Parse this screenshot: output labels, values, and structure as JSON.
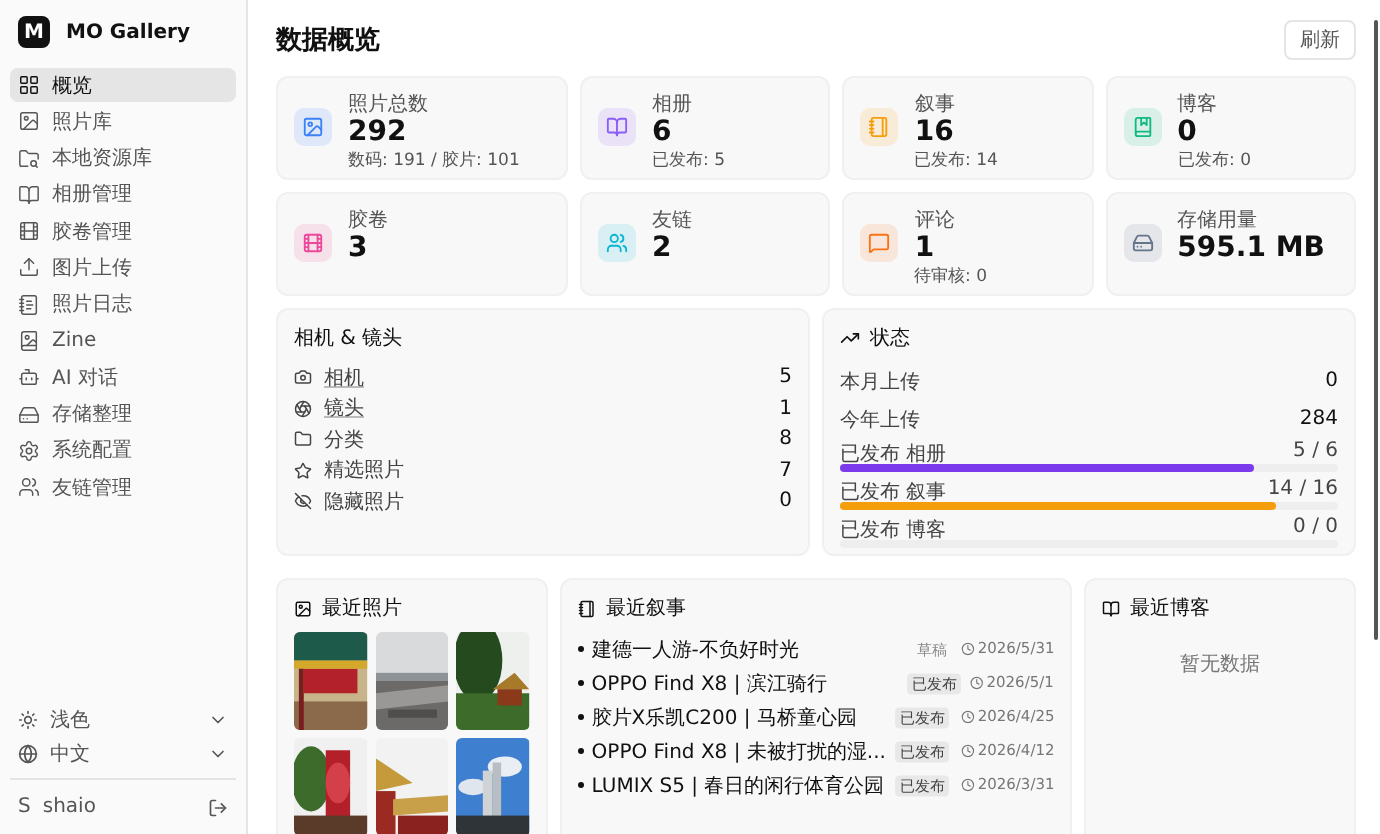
{
  "app": {
    "logo": "M",
    "name": "MO Gallery"
  },
  "sidebar": {
    "items": [
      {
        "label": "概览",
        "selected": true
      },
      {
        "label": "照片库",
        "selected": false
      },
      {
        "label": "本地资源库",
        "selected": false
      },
      {
        "label": "相册管理",
        "selected": false
      },
      {
        "label": "胶卷管理",
        "selected": false
      },
      {
        "label": "图片上传",
        "selected": false
      },
      {
        "label": "照片日志",
        "selected": false
      },
      {
        "label": "Zine",
        "selected": false
      },
      {
        "label": "AI 对话",
        "selected": false
      },
      {
        "label": "存储整理",
        "selected": false
      },
      {
        "label": "系统配置",
        "selected": false
      },
      {
        "label": "友链管理",
        "selected": false
      }
    ],
    "theme": "浅色",
    "language": "中文",
    "user": {
      "avatar": "S",
      "name": "shaio"
    }
  },
  "header": {
    "title": "数据概览",
    "refresh": "刷新"
  },
  "stats": [
    {
      "label": "照片总数",
      "value": "292",
      "sub": "数码: 191 / 胶片: 101",
      "color": "#3b82f6"
    },
    {
      "label": "相册",
      "value": "6",
      "sub": "已发布: 5",
      "color": "#8b5cf6"
    },
    {
      "label": "叙事",
      "value": "16",
      "sub": "已发布: 14",
      "color": "#f59e0b"
    },
    {
      "label": "博客",
      "value": "0",
      "sub": "已发布: 0",
      "color": "#10b981"
    },
    {
      "label": "胶卷",
      "value": "3",
      "color": "#ec4899"
    },
    {
      "label": "友链",
      "value": "2",
      "color": "#06b6d4"
    },
    {
      "label": "评论",
      "value": "1",
      "sub": "待审核: 0",
      "color": "#f97316"
    },
    {
      "label": "存储用量",
      "value": "595.1 MB",
      "color": "#64748b"
    }
  ],
  "camera_panel": {
    "title": "相机 & 镜头",
    "items": [
      {
        "label": "相机",
        "count": "5",
        "linked": true
      },
      {
        "label": "镜头",
        "count": "1",
        "linked": true
      },
      {
        "label": "分类",
        "count": "8",
        "linked": false
      },
      {
        "label": "精选照片",
        "count": "7",
        "linked": false
      },
      {
        "label": "隐藏照片",
        "count": "0",
        "linked": false
      }
    ]
  },
  "status_panel": {
    "title": "状态",
    "rows": [
      {
        "label": "本月上传",
        "value": "0"
      },
      {
        "label": "今年上传",
        "value": "284"
      }
    ],
    "progress": [
      {
        "label": "已发布 相册",
        "reading": "5 / 6",
        "level": 0.833,
        "color": "#7c3aed"
      },
      {
        "label": "已发布 叙事",
        "reading": "14 / 16",
        "level": 0.875,
        "color": "#f59e0b"
      },
      {
        "label": "已发布 博客",
        "reading": "0 / 0"
      }
    ]
  },
  "recent_photos": {
    "title": "最近照片"
  },
  "recent_stories": {
    "title": "最近叙事",
    "items": [
      {
        "title": "建德一人游-不负好时光",
        "status": "草稿",
        "draft": true,
        "date": "2026/5/31"
      },
      {
        "title": "OPPO Find X8 | 滨江骑行",
        "status": "已发布",
        "draft": false,
        "date": "2026/5/1"
      },
      {
        "title": "胶片X乐凯C200 | 马桥童心园",
        "status": "已发布",
        "draft": false,
        "date": "2026/4/25"
      },
      {
        "title": "OPPO Find X8 | 未被打扰的湿...",
        "status": "已发布",
        "draft": false,
        "date": "2026/4/12"
      },
      {
        "title": "LUMIX S5 | 春日的闲行体育公园",
        "status": "已发布",
        "draft": false,
        "date": "2026/3/31"
      }
    ]
  },
  "recent_blogs": {
    "title": "最近博客",
    "empty": "暂无数据"
  }
}
